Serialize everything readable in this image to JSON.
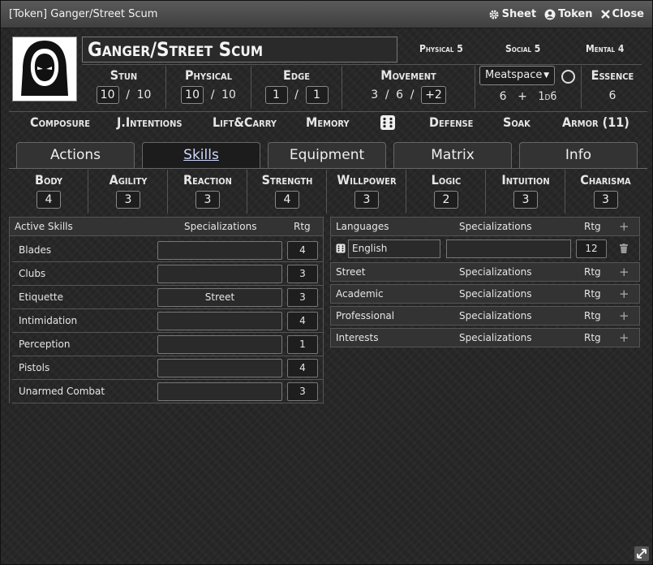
{
  "titlebar": {
    "title": "[Token] Ganger/Street Scum",
    "sheet_label": "Sheet",
    "token_label": "Token",
    "close_label": "Close"
  },
  "actor": {
    "name": "Ganger/Street Scum",
    "limits": {
      "physical": "Physical 5",
      "social": "Social 5",
      "mental": "Mental 4"
    }
  },
  "stats": {
    "stun": {
      "label": "Stun",
      "value": "10",
      "max": "10"
    },
    "physical": {
      "label": "Physical",
      "value": "10",
      "max": "10"
    },
    "edge": {
      "label": "Edge",
      "value": "1",
      "max": "1"
    },
    "movement": {
      "label": "Movement",
      "walk": "3",
      "run": "6",
      "mod": "+2"
    },
    "plane": {
      "selected": "Meatspace",
      "initiative": "6",
      "plus": "+",
      "dice": "1d6"
    },
    "essence": {
      "label": "Essence",
      "value": "6"
    }
  },
  "tests": {
    "composure": "Composure",
    "judge_intentions": "J.Intentions",
    "lift_carry": "Lift&Carry",
    "memory": "Memory",
    "defense": "Defense",
    "soak": "Soak",
    "armor": "Armor (11)"
  },
  "tabs": [
    "Actions",
    "Skills",
    "Equipment",
    "Matrix",
    "Info"
  ],
  "attributes": [
    {
      "label": "Body",
      "value": "4"
    },
    {
      "label": "Agility",
      "value": "3"
    },
    {
      "label": "Reaction",
      "value": "3"
    },
    {
      "label": "Strength",
      "value": "4"
    },
    {
      "label": "Willpower",
      "value": "3"
    },
    {
      "label": "Logic",
      "value": "2"
    },
    {
      "label": "Intuition",
      "value": "3"
    },
    {
      "label": "Charisma",
      "value": "3"
    }
  ],
  "active_skills": {
    "header": {
      "name": "Active Skills",
      "spec": "Specializations",
      "rtg": "Rtg"
    },
    "rows": [
      {
        "name": "Blades",
        "spec": "",
        "rtg": "4"
      },
      {
        "name": "Clubs",
        "spec": "",
        "rtg": "3"
      },
      {
        "name": "Etiquette",
        "spec": "Street",
        "rtg": "3"
      },
      {
        "name": "Intimidation",
        "spec": "",
        "rtg": "4"
      },
      {
        "name": "Perception",
        "spec": "",
        "rtg": "1"
      },
      {
        "name": "Pistols",
        "spec": "",
        "rtg": "4"
      },
      {
        "name": "Unarmed Combat",
        "spec": "",
        "rtg": "3"
      }
    ]
  },
  "knowledge": {
    "spec_label": "Specializations",
    "rtg_label": "Rtg",
    "add_symbol": "+",
    "languages_label": "Languages",
    "language_entry": {
      "name": "English",
      "spec": "",
      "rtg": "12"
    },
    "groups": [
      "Street",
      "Academic",
      "Professional",
      "Interests"
    ]
  },
  "colors": {
    "active_tab_text": "#cfd8ff",
    "background": "#262626"
  }
}
